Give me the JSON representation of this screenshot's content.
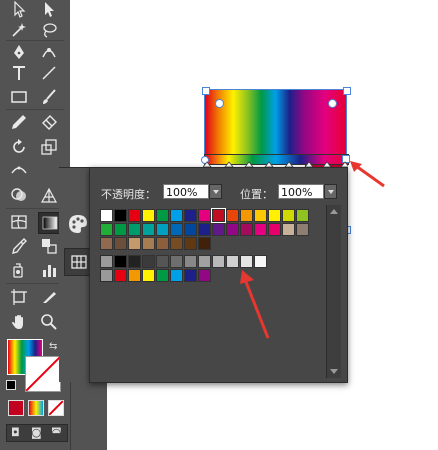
{
  "tools": {
    "icons": [
      "selection-arrow",
      "direct-selection-arrow",
      "magic-wand",
      "lasso",
      "pen",
      "curvature",
      "type",
      "line",
      "rectangle",
      "paintbrush",
      "pencil",
      "eraser",
      "rotate",
      "scale",
      "width",
      "free-transform",
      "shape-builder",
      "perspective",
      "mesh",
      "gradient",
      "eyedropper",
      "blend",
      "symbol-sprayer",
      "column-graph",
      "artboard",
      "slice",
      "hand",
      "zoom"
    ]
  },
  "swatch_panel": {
    "opacity_label": "不透明度：",
    "opacity_value": "100%",
    "position_label": "位置：",
    "position_value": "100%",
    "swatch_rows": [
      [
        "#ffffff",
        "#000000",
        "#e60012",
        "#fff100",
        "#009944",
        "#00a0e9",
        "#1d2088",
        "#e4007f",
        "#c30d23",
        "#e94709",
        "#f39800",
        "#fcc800",
        "#fff100",
        "#cfdb00",
        "#8fc31f"
      ],
      [
        "#22ac38",
        "#009944",
        "#009b6b",
        "#00a29a",
        "#00a0c1",
        "#0068b7",
        "#00479d",
        "#1d2088",
        "#601986",
        "#920783",
        "#a40b5d",
        "#e4007f",
        "#e5006a",
        "#c7b299",
        "#8f7e72"
      ],
      [
        "#8f6a50",
        "#6b4f3a",
        "#c49a6c",
        "#a67c52",
        "#8b5e3c",
        "#754c24",
        "#603913",
        "#42210b"
      ],
      [
        "#000000",
        "#222222",
        "#3b3b3b",
        "#555555",
        "#6e6e6e",
        "#888888",
        "#a1a1a1",
        "#b9b9b9",
        "#d0d0d0",
        "#e4e4e4",
        "#f7f7f7"
      ],
      [
        "#e60012",
        "#f39800",
        "#fff100",
        "#009944",
        "#00a0e9",
        "#1d2088",
        "#920783"
      ]
    ]
  },
  "gradient": {
    "stops": [
      "#e60012",
      "#f39800",
      "#fff100",
      "#8fc31f",
      "#009944",
      "#00a0e9",
      "#1d2088",
      "#920783",
      "#e4007f",
      "#e60033"
    ]
  },
  "fill_stroke": {
    "fill": "gradient",
    "stroke": "none"
  }
}
